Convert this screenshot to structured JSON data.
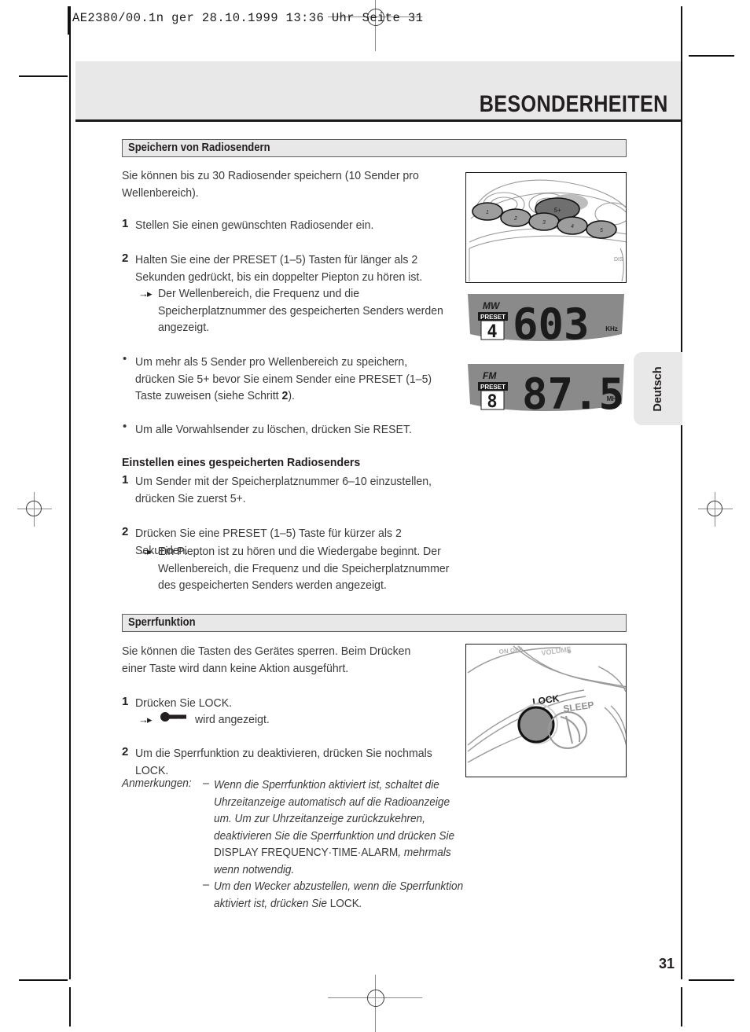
{
  "document": {
    "file_header": "AE2380/00.1n ger  28.10.1999  13:36 Uhr  Seite 31",
    "chapter_title": "BESONDERHEITEN",
    "page_number": "31",
    "language_tab": "Deutsch"
  },
  "sections": [
    {
      "heading": "Speichern von Radiosendern",
      "intro": "Sie können bis zu 30 Radiosender speichern (10 Sender pro Wellenbereich).",
      "steps": [
        {
          "number": "1",
          "text": "Stellen Sie einen gewünschten Radiosender ein."
        },
        {
          "number": "2",
          "text": "Halten Sie eine der PRESET (1–5) Tasten für länger als 2 Sekunden gedrückt, bis ein doppelter Piepton zu hören ist."
        }
      ],
      "result_note": "Der Wellenbereich, die Frequenz und die Speicherplatznummer des gespeicherten Senders werden angezeigt.",
      "bullets": [
        "Um mehr als 5 Sender pro Wellenbereich zu speichern, drücken Sie 5+ bevor Sie einem Sender eine PRESET (1–5) Taste zuweisen (siehe Schritt 2).",
        "Um alle Vorwahlsender zu löschen, drücken Sie RESET."
      ],
      "bullet_bold_ref": "2",
      "subsection": {
        "heading": "Einstellen eines gespeicherten Radiosenders",
        "steps": [
          {
            "number": "1",
            "text": "Um Sender mit der Speicherplatznummer 6–10 einzustellen, drücken Sie zuerst 5+."
          },
          {
            "number": "2",
            "text": "Drücken Sie eine PRESET (1–5) Taste für kürzer als 2 Sekunden."
          }
        ],
        "result_note": "Ein Piepton ist zu hören und die Wiedergabe beginnt. Der Wellenbereich, die Frequenz und die Speicherplatznummer des gespeicherten Senders werden angezeigt."
      }
    },
    {
      "heading": "Sperrfunktion",
      "intro": "Sie können die Tasten des Gerätes sperren. Beim Drücken einer Taste wird dann keine Aktion ausgeführt.",
      "steps": [
        {
          "number": "1",
          "text": "Drücken Sie LOCK."
        },
        {
          "number": "2",
          "text": "Um die Sperrfunktion zu deaktivieren, drücken Sie nochmals LOCK."
        }
      ],
      "result_note": "wird angezeigt.",
      "result_icon": "key-icon"
    }
  ],
  "notes": {
    "label": "Anmerkungen:",
    "dash": "–",
    "items": [
      {
        "part1": "Wenn die Sperrfunktion aktiviert ist, schaltet die Uhrzeitanzeige automatisch auf die Radioanzeige um. Um zur Uhrzeitanzeige zurückzukehren, deaktivieren Sie die Sperrfunktion und drücken Sie ",
        "roman": "DISPLAY FREQUENCY·TIME·ALARM",
        "part2": ", mehrmals wenn notwendig."
      },
      {
        "part1": "Um den Wecker abzustellen, wenn die Sperrfunktion aktiviert ist, drücken Sie ",
        "roman": "LOCK",
        "part2": "."
      }
    ]
  },
  "figures": {
    "preset_buttons_photo": {
      "name": "radio-top-panel-preset-buttons",
      "buttons": [
        "1",
        "2",
        "3",
        "4",
        "5"
      ],
      "highlight_button": "5+",
      "side_label": "DIS"
    },
    "lcd_mw": {
      "band": "MW",
      "preset_label": "PRESET",
      "preset_number": "4",
      "frequency": "603",
      "unit": "KHz",
      "panel_color": "#8a8a8a"
    },
    "lcd_fm": {
      "band": "FM",
      "preset_label": "PRESET",
      "preset_number": "8",
      "frequency": "87.5",
      "unit": "MHz",
      "panel_color": "#8a8a8a"
    },
    "lock_photo": {
      "name": "radio-lock-button-photo",
      "labels": [
        "VOLUME",
        "LOCK",
        "SLEEP"
      ]
    }
  }
}
